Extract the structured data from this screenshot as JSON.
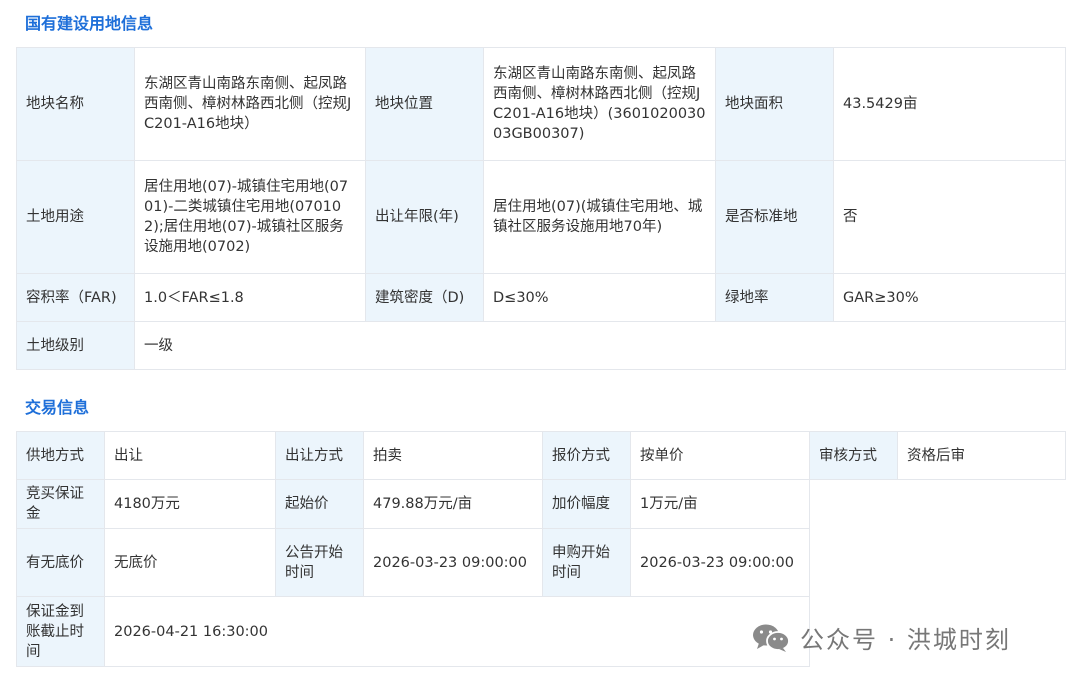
{
  "land_info": {
    "title": "国有建设用地信息",
    "rows": [
      [
        {
          "label": "地块名称",
          "value": "东湖区青山南路东南侧、起凤路西南侧、樟树林路西北侧（控规JC201-A16地块）"
        },
        {
          "label": "地块位置",
          "value": "东湖区青山南路东南侧、起凤路西南侧、樟树林路西北侧（控规JC201-A16地块）(360102003003GB00307)"
        },
        {
          "label": "地块面积",
          "value": "43.5429亩"
        }
      ],
      [
        {
          "label": "土地用途",
          "value": "居住用地(07)-城镇住宅用地(0701)-二类城镇住宅用地(070102);居住用地(07)-城镇社区服务设施用地(0702)"
        },
        {
          "label": "出让年限(年)",
          "value": "居住用地(07)(城镇住宅用地、城镇社区服务设施用地70年)"
        },
        {
          "label": "是否标准地",
          "value": "否"
        }
      ],
      [
        {
          "label": "容积率（FAR)",
          "value": "1.0＜FAR≤1.8"
        },
        {
          "label": "建筑密度（D)",
          "value": "D≤30%"
        },
        {
          "label": "绿地率",
          "value": "GAR≥30%"
        }
      ],
      [
        {
          "label": "土地级别",
          "value": "一级"
        }
      ]
    ]
  },
  "trade_info": {
    "title": "交易信息",
    "row1": [
      {
        "label": "供地方式",
        "value": "出让"
      },
      {
        "label": "出让方式",
        "value": "拍卖"
      },
      {
        "label": "报价方式",
        "value": "按单价"
      },
      {
        "label": "审核方式",
        "value": "资格后审"
      }
    ],
    "row2": [
      {
        "label": "竞买保证金",
        "value": "4180万元"
      },
      {
        "label": "起始价",
        "value": "479.88万元/亩"
      },
      {
        "label": "加价幅度",
        "value": "1万元/亩"
      }
    ],
    "row3": [
      {
        "label": "有无底价",
        "value": "无底价"
      },
      {
        "label": "公告开始时间",
        "value": "2026-03-23 09:00:00"
      },
      {
        "label": "申购开始时间",
        "value": "2026-03-23 09:00:00"
      }
    ],
    "row4": [
      {
        "label": "保证金到账截止时间",
        "value": "2026-04-21 16:30:00"
      }
    ]
  },
  "watermark": {
    "icon": "wechat-icon",
    "text": "公众号 · 洪城时刻"
  },
  "colors": {
    "title": "#1e6fd9",
    "label_bg": "#ecf5fc",
    "border": "#e4e7ec"
  }
}
